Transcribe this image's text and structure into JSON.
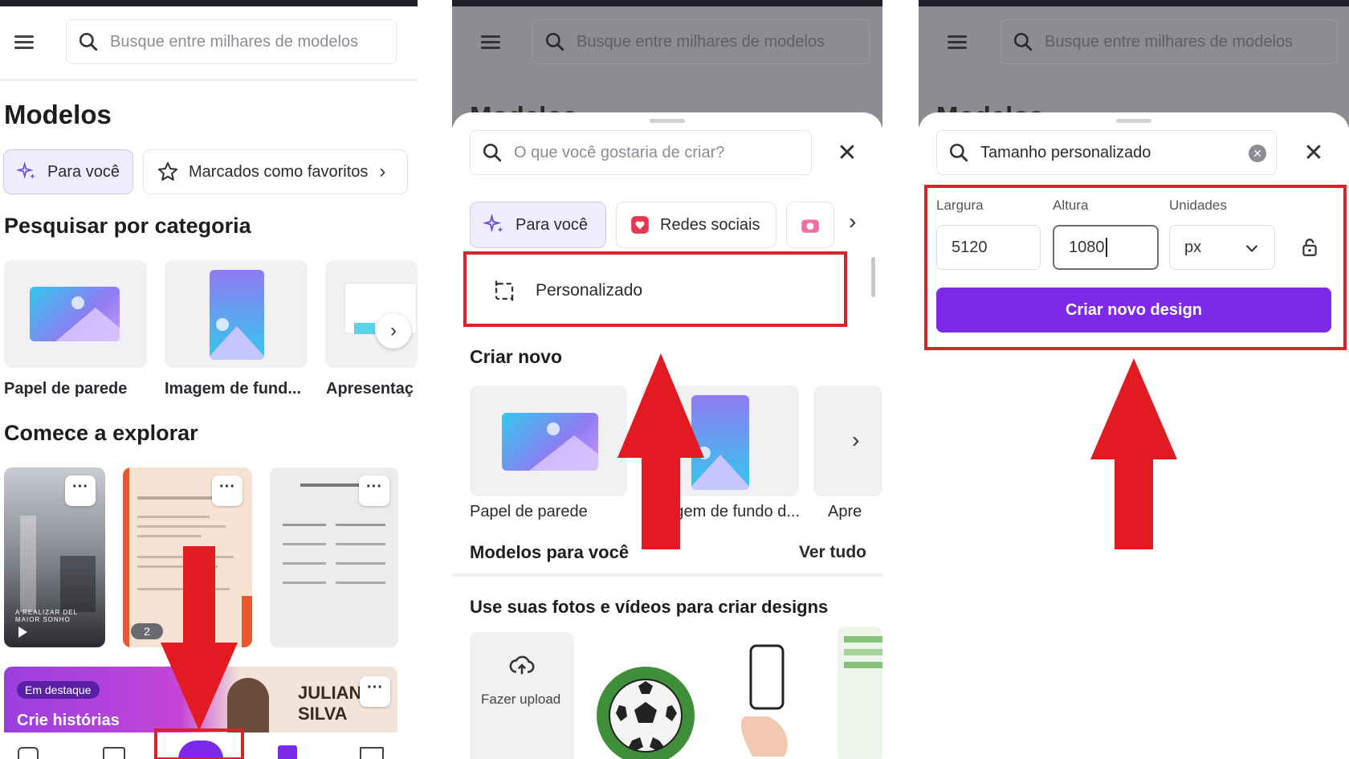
{
  "panel1": {
    "search_placeholder": "Busque entre milhares de modelos",
    "title": "Modelos",
    "chips": [
      {
        "label": "Para você",
        "icon": "sparkle-icon"
      },
      {
        "label": "Marcados como favoritos",
        "icon": "star-icon"
      }
    ],
    "category_heading": "Pesquisar por categoria",
    "categories": [
      "Papel de parede",
      "Imagem de fund...",
      "Apresentaç"
    ],
    "explore_heading": "Comece a explorar",
    "explore_cards": {
      "card1_text": "A REALIZAR DEL MAIOR SONHO",
      "card2_badge": "2",
      "featured_badge": "Em destaque",
      "featured_text": "Crie histórias",
      "featured_name_1": "JULIAN",
      "featured_name_2": "SILVA"
    }
  },
  "panel2": {
    "search_placeholder": "Busque entre milhares de modelos",
    "bg_title": "Modelos",
    "sheet_search_placeholder": "O que você gostaria de criar?",
    "chips": [
      {
        "label": "Para você",
        "icon": "sparkle-icon"
      },
      {
        "label": "Redes sociais",
        "icon": "heart-icon"
      }
    ],
    "custom_label": "Personalizado",
    "create_heading": "Criar novo",
    "create_items": [
      "Papel de parede",
      "Imagem de fundo d...",
      "Apre"
    ],
    "for_you_heading": "Modelos para você",
    "see_all": "Ver tudo",
    "photos_heading": "Use suas fotos e vídeos para criar designs",
    "upload_label": "Fazer upload"
  },
  "panel3": {
    "search_placeholder": "Busque entre milhares de modelos",
    "bg_title": "Modelos",
    "sheet_search_value": "Tamanho personalizado",
    "width_label": "Largura",
    "height_label": "Altura",
    "units_label": "Unidades",
    "width_value": "5120",
    "height_value": "1080",
    "units_value": "px",
    "create_button": "Criar novo design"
  },
  "colors": {
    "accent": "#7d2ae8",
    "highlight_red": "#d8232a",
    "arrow_red": "#e21b23"
  }
}
